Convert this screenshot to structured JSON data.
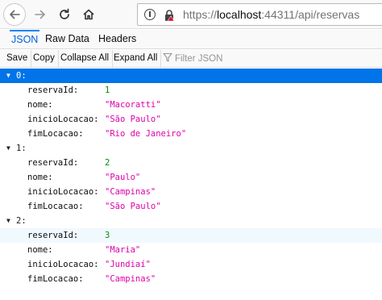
{
  "browser": {
    "url_prefix": "https://",
    "url_host": "localhost",
    "url_rest": ":44311/api/reservas"
  },
  "tabs": [
    "JSON",
    "Raw Data",
    "Headers"
  ],
  "toolbar": {
    "save": "Save",
    "copy": "Copy",
    "collapse_all": "Collapse All",
    "expand_all": "Expand All",
    "filter_placeholder": "Filter JSON"
  },
  "json": {
    "items": [
      {
        "index": "0:",
        "fields": [
          {
            "key": "reservaId:",
            "value": "1",
            "type": "num"
          },
          {
            "key": "nome:",
            "value": "\"Macoratti\"",
            "type": "str"
          },
          {
            "key": "inicioLocacao:",
            "value": "\"São Paulo\"",
            "type": "str"
          },
          {
            "key": "fimLocacao:",
            "value": "\"Rio de Janeiro\"",
            "type": "str"
          }
        ]
      },
      {
        "index": "1:",
        "fields": [
          {
            "key": "reservaId:",
            "value": "2",
            "type": "num"
          },
          {
            "key": "nome:",
            "value": "\"Paulo\"",
            "type": "str"
          },
          {
            "key": "inicioLocacao:",
            "value": "\"Campinas\"",
            "type": "str"
          },
          {
            "key": "fimLocacao:",
            "value": "\"São Paulo\"",
            "type": "str"
          }
        ]
      },
      {
        "index": "2:",
        "fields": [
          {
            "key": "reservaId:",
            "value": "3",
            "type": "num"
          },
          {
            "key": "nome:",
            "value": "\"Maria\"",
            "type": "str"
          },
          {
            "key": "inicioLocacao:",
            "value": "\"Jundiaí\"",
            "type": "str"
          },
          {
            "key": "fimLocacao:",
            "value": "\"Campinas\"",
            "type": "str"
          }
        ]
      }
    ]
  },
  "colors": {
    "selected_row": "#0074e8",
    "number": "#058b00",
    "string": "#dd00a9",
    "active_tab": "#0060df"
  }
}
